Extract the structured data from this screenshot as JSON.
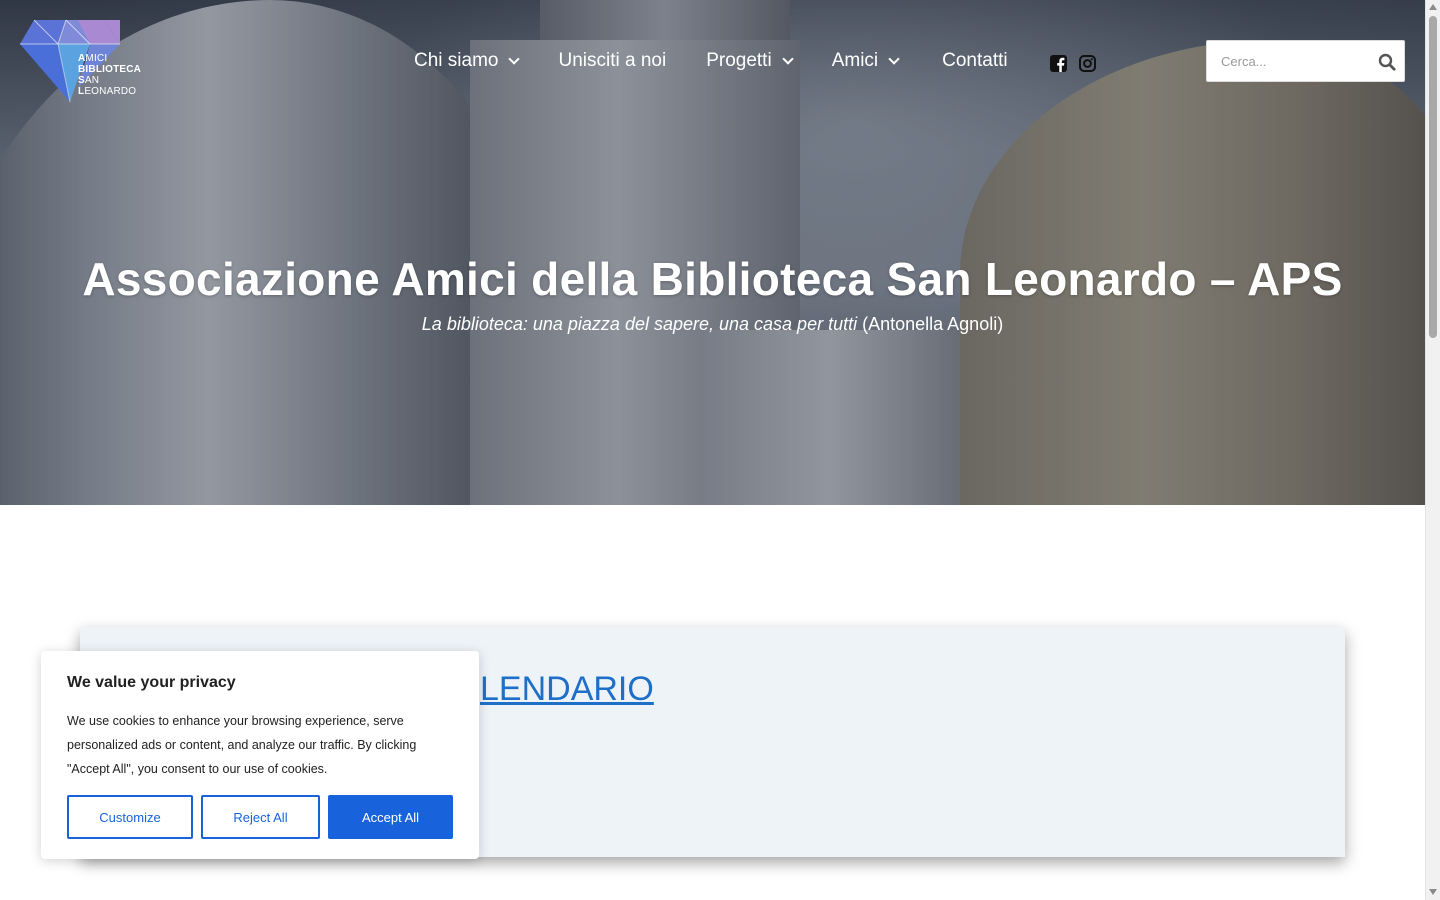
{
  "header": {
    "logo": {
      "lines": [
        {
          "initial": "A",
          "rest": "MICI"
        },
        {
          "initial": "B",
          "rest": "IBLIOTECA"
        },
        {
          "initial": "S",
          "rest": "AN"
        },
        {
          "initial": "L",
          "rest": "EONARDO"
        }
      ],
      "colors": {
        "left": "#5b73d6",
        "right": "#a98ad2",
        "tip": "#5aa2e0"
      }
    },
    "nav": [
      {
        "label": "Chi siamo",
        "has_dropdown": true
      },
      {
        "label": "Unisciti a noi",
        "has_dropdown": false
      },
      {
        "label": "Progetti",
        "has_dropdown": true
      },
      {
        "label": "Amici",
        "has_dropdown": true
      },
      {
        "label": "Contatti",
        "has_dropdown": false
      }
    ],
    "social": [
      {
        "icon": "facebook-square-icon"
      },
      {
        "icon": "instagram-icon"
      }
    ],
    "search": {
      "placeholder": "Cerca...",
      "value": "",
      "icon": "search-icon"
    }
  },
  "hero": {
    "title": "Associazione Amici della Biblioteca San Leonardo – APS",
    "subtitle_italic": "La biblioteca: una piazza del sapere, una casa per tutti",
    "subtitle_author": "(Antonella Agnoli)"
  },
  "card": {
    "link_text": "LENDARIO",
    "link_color": "#1e6fc8",
    "background": "#eef3f8"
  },
  "cookie_banner": {
    "title": "We value your privacy",
    "text": "We use cookies to enhance your browsing experience, serve personalized ads or content, and analyze our traffic. By clicking \"Accept All\", you consent to our use of cookies.",
    "buttons": {
      "customize": "Customize",
      "reject": "Reject All",
      "accept": "Accept All"
    },
    "accent_color": "#1863dc"
  }
}
